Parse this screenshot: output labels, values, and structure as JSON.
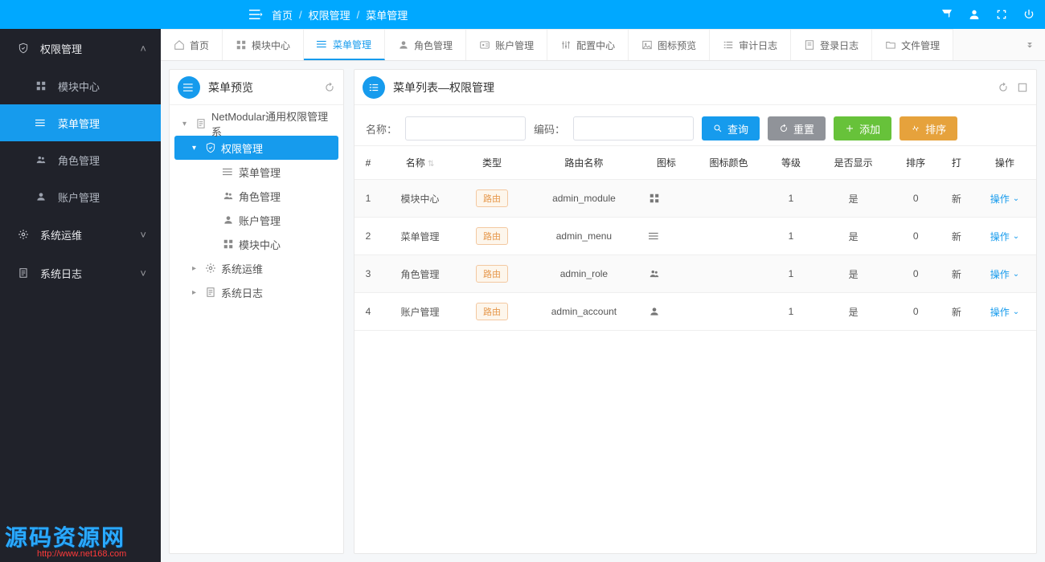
{
  "topbar": {
    "breadcrumb": [
      "首页",
      "权限管理",
      "菜单管理"
    ]
  },
  "sidebar": {
    "groups": [
      {
        "label": "权限管理",
        "expanded": true,
        "icon": "shield",
        "items": [
          {
            "label": "模块中心",
            "icon": "grid"
          },
          {
            "label": "菜单管理",
            "icon": "menu",
            "active": true
          },
          {
            "label": "角色管理",
            "icon": "users"
          },
          {
            "label": "账户管理",
            "icon": "user"
          }
        ]
      },
      {
        "label": "系统运维",
        "expanded": false,
        "icon": "gear"
      },
      {
        "label": "系统日志",
        "expanded": false,
        "icon": "doc"
      }
    ]
  },
  "tabs": [
    {
      "label": "首页",
      "icon": "home"
    },
    {
      "label": "模块中心",
      "icon": "grid"
    },
    {
      "label": "菜单管理",
      "icon": "menu",
      "active": true
    },
    {
      "label": "角色管理",
      "icon": "user"
    },
    {
      "label": "账户管理",
      "icon": "id"
    },
    {
      "label": "配置中心",
      "icon": "sliders"
    },
    {
      "label": "图标预览",
      "icon": "image"
    },
    {
      "label": "审计日志",
      "icon": "list"
    },
    {
      "label": "登录日志",
      "icon": "log"
    },
    {
      "label": "文件管理",
      "icon": "folder"
    }
  ],
  "leftPanel": {
    "title": "菜单预览",
    "tree": {
      "root": "NetModular通用权限管理系",
      "nodes": [
        {
          "label": "权限管理",
          "icon": "shield",
          "active": true,
          "children": [
            {
              "label": "菜单管理",
              "icon": "menu"
            },
            {
              "label": "角色管理",
              "icon": "users"
            },
            {
              "label": "账户管理",
              "icon": "user"
            },
            {
              "label": "模块中心",
              "icon": "grid"
            }
          ]
        },
        {
          "label": "系统运维",
          "icon": "gear"
        },
        {
          "label": "系统日志",
          "icon": "doc"
        }
      ]
    }
  },
  "rightPanel": {
    "title": "菜单列表—权限管理",
    "search": {
      "nameLabel": "名称：",
      "codeLabel": "编码：",
      "queryBtn": "查询",
      "resetBtn": "重置",
      "addBtn": "添加",
      "sortBtn": "排序"
    },
    "columns": [
      "#",
      "名称",
      "类型",
      "路由名称",
      "图标",
      "图标颜色",
      "等级",
      "是否显示",
      "排序",
      "打",
      "操作"
    ],
    "typeTag": "路由",
    "opLabel": "操作",
    "rows": [
      {
        "idx": "1",
        "name": "模块中心",
        "route": "admin_module",
        "icon": "grid",
        "color": "",
        "level": "1",
        "show": "是",
        "sort": "0",
        "open": "新"
      },
      {
        "idx": "2",
        "name": "菜单管理",
        "route": "admin_menu",
        "icon": "menu",
        "color": "",
        "level": "1",
        "show": "是",
        "sort": "0",
        "open": "新"
      },
      {
        "idx": "3",
        "name": "角色管理",
        "route": "admin_role",
        "icon": "users",
        "color": "",
        "level": "1",
        "show": "是",
        "sort": "0",
        "open": "新"
      },
      {
        "idx": "4",
        "name": "账户管理",
        "route": "admin_account",
        "icon": "user",
        "color": "",
        "level": "1",
        "show": "是",
        "sort": "0",
        "open": "新"
      }
    ]
  },
  "watermark": {
    "line1": "源码资源网",
    "line2": "http://www.net168.com"
  }
}
